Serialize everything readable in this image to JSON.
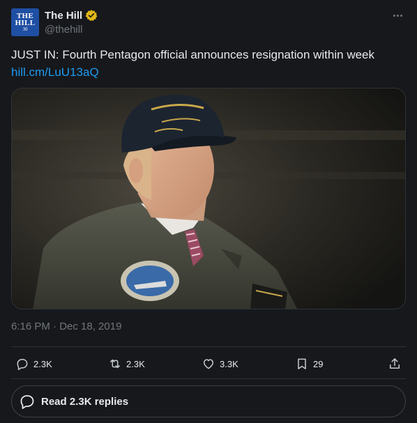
{
  "author": {
    "display_name": "The Hill",
    "handle": "@thehill",
    "avatar_lines": [
      "THE",
      "HILL",
      "30"
    ],
    "verified_color": "#e2b719"
  },
  "tweet": {
    "text": "JUST IN: Fourth Pentagon official announces resignation within week",
    "link": "hill.cm/LuU13aQ",
    "timestamp": "6:16 PM · Dec 18, 2019"
  },
  "actions": {
    "replies": "2.3K",
    "retweets": "2.3K",
    "likes": "3.3K",
    "bookmarks": "29"
  },
  "read_replies_label": "Read 2.3K replies",
  "colors": {
    "background": "#16181c",
    "text": "#e7e9ea",
    "muted": "#71767b",
    "link": "#1d9bf0",
    "border": "#2f3336"
  }
}
